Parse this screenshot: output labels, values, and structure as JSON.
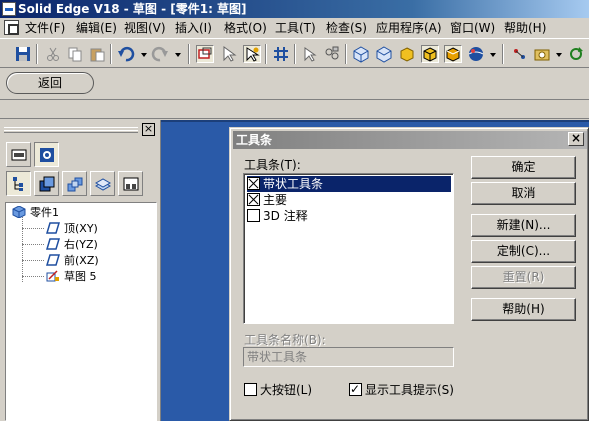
{
  "window": {
    "title": "Solid Edge V18 - 草图 - [零件1: 草图]"
  },
  "menu": [
    "文件(F)",
    "编辑(E)",
    "视图(V)",
    "插入(I)",
    "格式(O)",
    "工具(T)",
    "检查(S)",
    "应用程序(A)",
    "窗口(W)",
    "帮助(H)"
  ],
  "command_bar": {
    "back_label": "返回"
  },
  "tree": {
    "root": "零件1",
    "items": [
      "顶(XY)",
      "右(YZ)",
      "前(XZ)",
      "草图 5"
    ]
  },
  "dialog": {
    "title": "工具条",
    "list_label": "工具条(T):",
    "items": [
      {
        "label": "带状工具条",
        "checked": true,
        "selected": true
      },
      {
        "label": "主要",
        "checked": true,
        "selected": false
      },
      {
        "label": "3D 注释",
        "checked": false,
        "selected": false
      }
    ],
    "buttons": {
      "ok": "确定",
      "cancel": "取消",
      "new": "新建(N)...",
      "customize": "定制(C)...",
      "reset": "重置(R)",
      "help": "帮助(H)"
    },
    "name_label": "工具条名称(B):",
    "name_value": "带状工具条",
    "large_buttons_label": "大按钮(L)",
    "large_buttons_checked": false,
    "tooltips_label": "显示工具提示(S)",
    "tooltips_checked": true
  }
}
